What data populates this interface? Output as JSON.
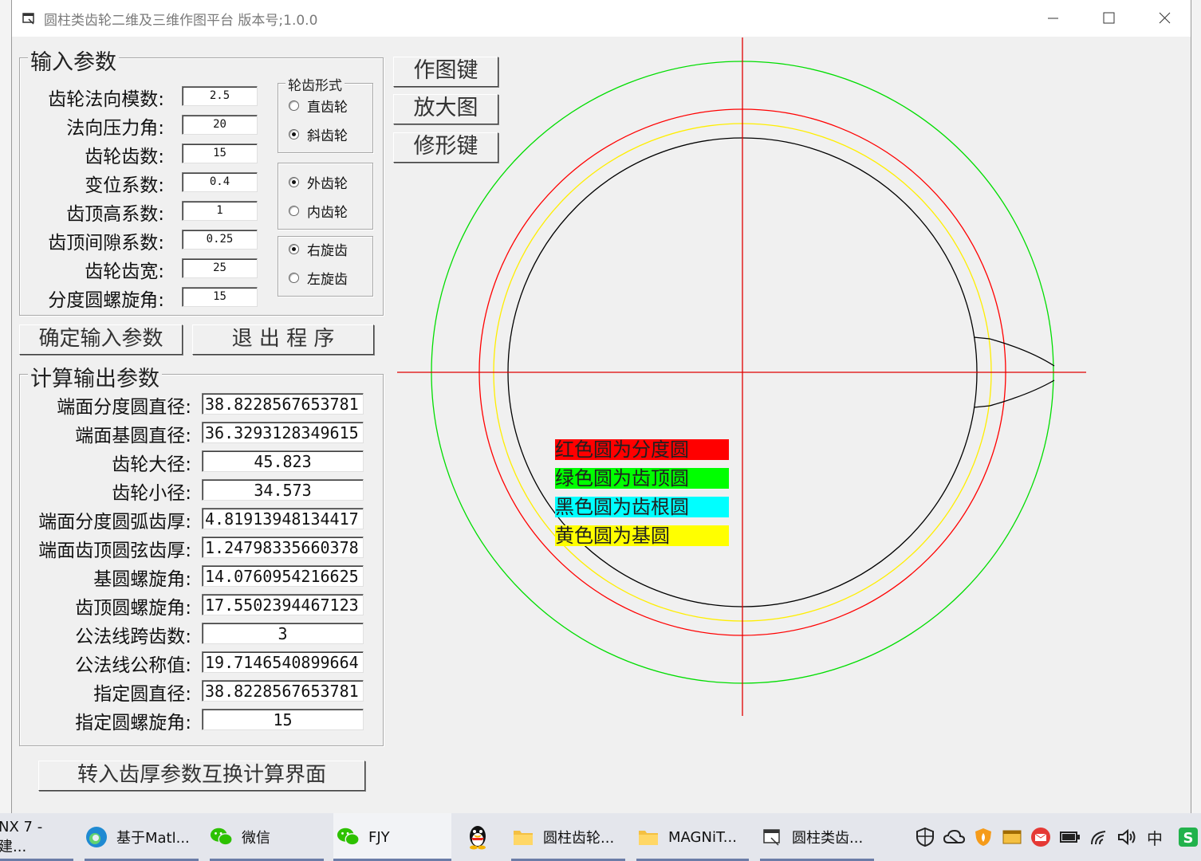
{
  "window": {
    "title": "圆柱类齿轮二维及三维作图平台 版本号;1.0.0",
    "colors": {
      "bg": "#f0f0f0",
      "titlebar": "#ffffff"
    }
  },
  "input_group": {
    "title": "输入参数",
    "params": [
      {
        "label": "齿轮法向模数:",
        "value": "2.5"
      },
      {
        "label": "法向压力角:",
        "value": "20"
      },
      {
        "label": "齿轮齿数:",
        "value": "15"
      },
      {
        "label": "变位系数:",
        "value": "0.4"
      },
      {
        "label": "齿顶高系数:",
        "value": "1"
      },
      {
        "label": "齿顶间隙系数:",
        "value": "0.25"
      },
      {
        "label": "齿轮齿宽:",
        "value": "25"
      },
      {
        "label": "分度圆螺旋角:",
        "value": "15"
      }
    ],
    "tooth_form": {
      "title": "轮齿形式",
      "options": [
        {
          "label": "直齿轮",
          "checked": false
        },
        {
          "label": "斜齿轮",
          "checked": true
        }
      ]
    },
    "gear_type": {
      "options": [
        {
          "label": "外齿轮",
          "checked": true
        },
        {
          "label": "内齿轮",
          "checked": false
        }
      ]
    },
    "helix_dir": {
      "options": [
        {
          "label": "右旋齿",
          "checked": true
        },
        {
          "label": "左旋齿",
          "checked": false
        }
      ]
    }
  },
  "buttons": {
    "draw": "作图键",
    "zoom": "放大图",
    "modify": "修形键",
    "confirm": "确定输入参数",
    "exit": "退 出 程 序",
    "convert": "转入齿厚参数互换计算界面"
  },
  "output_group": {
    "title": "计算输出参数",
    "params": [
      {
        "label": "端面分度圆直径:",
        "value": "38.8228567653781"
      },
      {
        "label": "端面基圆直径:",
        "value": "36.3293128349615"
      },
      {
        "label": "齿轮大径:",
        "value": "45.823"
      },
      {
        "label": "齿轮小径:",
        "value": "34.573"
      },
      {
        "label": "端面分度圆弧齿厚:",
        "value": "4.81913948134417"
      },
      {
        "label": "端面齿顶圆弦齿厚:",
        "value": "1.24798335660378"
      },
      {
        "label": "基圆螺旋角:",
        "value": "14.0760954216625"
      },
      {
        "label": "齿顶圆螺旋角:",
        "value": "17.5502394467123"
      },
      {
        "label": "公法线跨齿数:",
        "value": "3"
      },
      {
        "label": "公法线公称值:",
        "value": "19.7146540899664"
      },
      {
        "label": "指定圆直径:",
        "value": "38.8228567653781"
      },
      {
        "label": "指定圆螺旋角:",
        "value": "15"
      }
    ]
  },
  "legend": [
    {
      "text": "红色圆为分度圆",
      "color": "#ff0000"
    },
    {
      "text": "绿色圆为齿顶圆",
      "color": "#00ff00"
    },
    {
      "text": "黑色圆为齿根圆",
      "color": "#00ffff"
    },
    {
      "text": "黄色圆为基圆",
      "color": "#ffff00"
    }
  ],
  "plot_colors": {
    "addendum": "#00dd00",
    "pitch": "#ff0000",
    "base": "#ffee00",
    "root": "#000000",
    "axis": "#e00000"
  },
  "taskbar": {
    "items": [
      {
        "label": "NX 7 - 建..."
      },
      {
        "label": "基于Matl..."
      },
      {
        "label": "微信"
      },
      {
        "label": "FJY"
      },
      {
        "label": "圆柱齿轮..."
      },
      {
        "label": "MAGNiT..."
      },
      {
        "label": "圆柱类齿..."
      }
    ],
    "tray_ime": "中"
  }
}
